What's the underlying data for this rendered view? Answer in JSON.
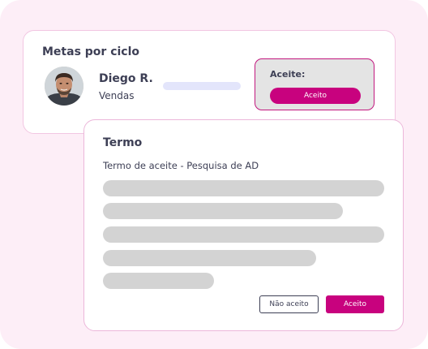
{
  "goals_card": {
    "title": "Metas por ciclo",
    "user": {
      "name": "Diego R.",
      "department": "Vendas",
      "avatar_icon": "person-photo-avatar"
    },
    "acceptance": {
      "label": "Aceite:",
      "button_label": "Aceito"
    }
  },
  "term_modal": {
    "title": "Termo",
    "subtitle": "Termo de aceite - Pesquisa de AD",
    "decline_label": "Não aceito",
    "accept_label": "Aceito"
  },
  "colors": {
    "accent": "#c8027e",
    "background": "#fdeef7",
    "text": "#3d3f55",
    "skeleton": "#d3d3d3"
  }
}
